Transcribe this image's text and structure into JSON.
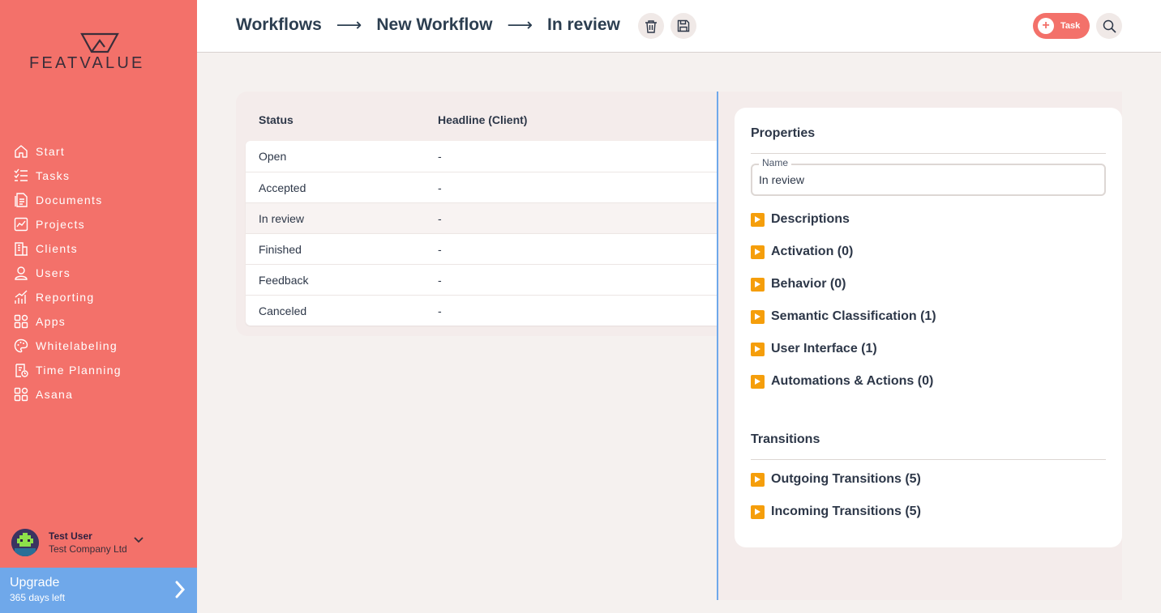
{
  "brand": {
    "logo_text": "FEATVALUE",
    "accent": "#f3716a",
    "upgrade_color": "#6fa8ea",
    "warning": "#f59e0b"
  },
  "sidebar": {
    "items": [
      {
        "label": "Start",
        "icon": "home-icon"
      },
      {
        "label": "Tasks",
        "icon": "tasks-icon"
      },
      {
        "label": "Documents",
        "icon": "documents-icon"
      },
      {
        "label": "Projects",
        "icon": "projects-icon"
      },
      {
        "label": "Clients",
        "icon": "clients-icon"
      },
      {
        "label": "Users",
        "icon": "user-icon"
      },
      {
        "label": "Reporting",
        "icon": "reporting-icon"
      },
      {
        "label": "Apps",
        "icon": "apps-icon"
      },
      {
        "label": "Whitelabeling",
        "icon": "palette-icon"
      },
      {
        "label": "Time Planning",
        "icon": "time-planning-icon"
      },
      {
        "label": "Asana",
        "icon": "apps-icon"
      }
    ],
    "user": {
      "name": "Test User",
      "company": "Test Company Ltd"
    },
    "upgrade": {
      "title": "Upgrade",
      "subtitle": "365 days left"
    }
  },
  "header": {
    "breadcrumbs": [
      "Workflows",
      "New Workflow",
      "In review"
    ],
    "arrow": "⟶",
    "task_button": "Task"
  },
  "table": {
    "columns": [
      "Status",
      "Headline (Client)"
    ],
    "rows": [
      {
        "status": "Open",
        "headline": "-"
      },
      {
        "status": "Accepted",
        "headline": "-"
      },
      {
        "status": "In review",
        "headline": "-"
      },
      {
        "status": "Finished",
        "headline": "-"
      },
      {
        "status": "Feedback",
        "headline": "-"
      },
      {
        "status": "Canceled",
        "headline": "-"
      }
    ],
    "selected": "In review"
  },
  "properties": {
    "title": "Properties",
    "name_label": "Name",
    "name_value": "In review",
    "sections": [
      "Descriptions",
      "Activation (0)",
      "Behavior (0)",
      "Semantic Classification (1)",
      "User Interface (1)",
      "Automations & Actions (0)"
    ]
  },
  "transitions": {
    "title": "Transitions",
    "sections": [
      "Outgoing Transitions (5)",
      "Incoming Transitions (5)"
    ]
  }
}
